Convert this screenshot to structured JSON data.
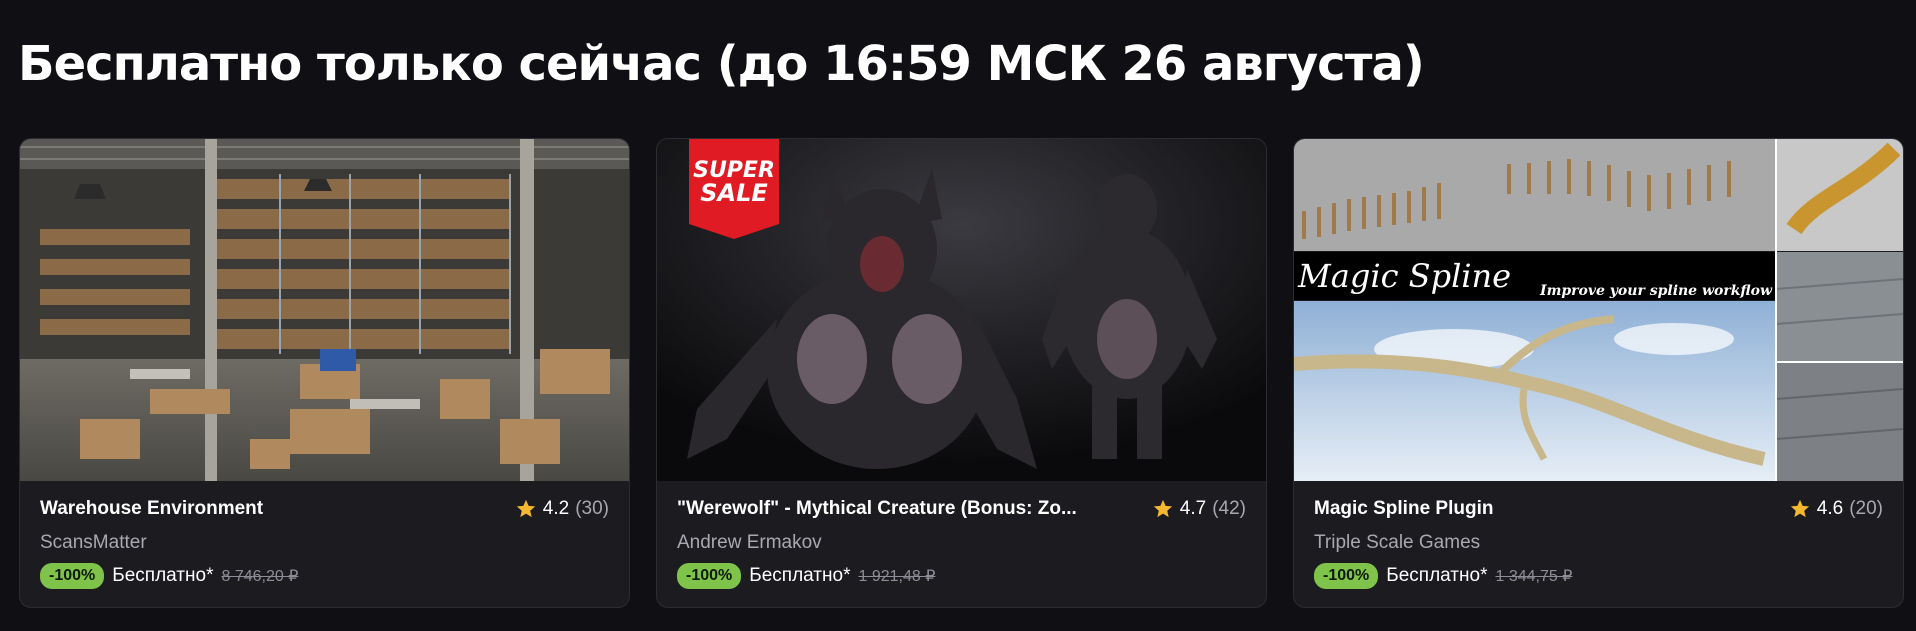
{
  "section": {
    "title": "Бесплатно только сейчас (до 16:59 МСК 26 августа)"
  },
  "cards": [
    {
      "title": "Warehouse Environment",
      "rating": "4.2",
      "reviews": "(30)",
      "author": "ScansMatter",
      "discount": "-100%",
      "price": "Бесплатно*",
      "old_price": "8 746,20 ₽",
      "image": "warehouse-interior"
    },
    {
      "title": "\"Werewolf\" - Mythical Creature (Bonus: Zo...",
      "rating": "4.7",
      "reviews": "(42)",
      "author": "Andrew Ermakov",
      "discount": "-100%",
      "price": "Бесплатно*",
      "old_price": "1 921,48 ₽",
      "image": "werewolf-creature",
      "badge": {
        "line1": "SUPER",
        "line2": "SALE"
      }
    },
    {
      "title": "Magic Spline Plugin",
      "rating": "4.6",
      "reviews": "(20)",
      "author": "Triple Scale Games",
      "discount": "-100%",
      "price": "Бесплатно*",
      "old_price": "1 344,75 ₽",
      "image": "magic-spline-collage",
      "banner": {
        "title": "Magic Spline",
        "subtitle": "Improve your spline workflow"
      }
    }
  ],
  "colors": {
    "background": "#101014",
    "card": "#1b1b20",
    "discount_badge": "#7fc34b",
    "star": "#f5b82e",
    "sale_badge": "#e01b24"
  }
}
